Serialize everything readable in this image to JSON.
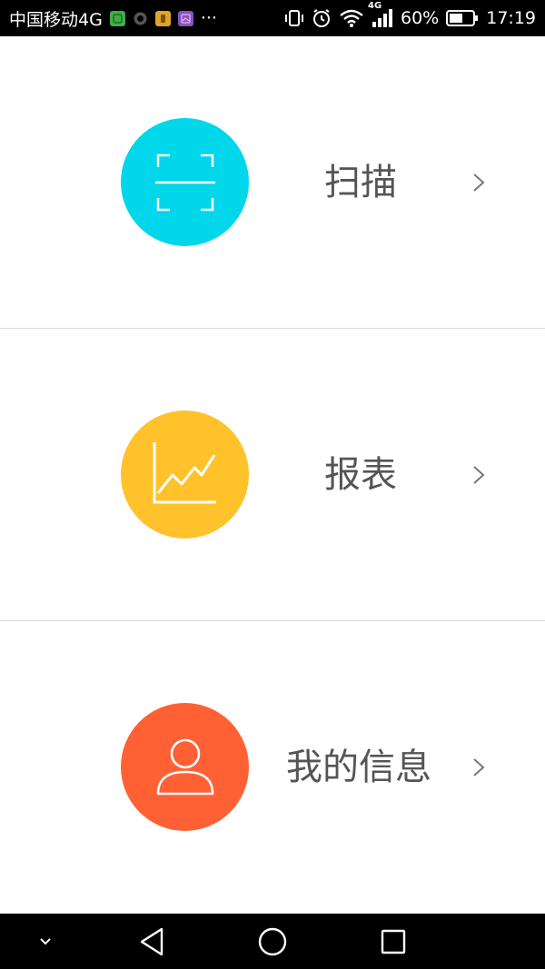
{
  "status_bar": {
    "carrier": "中国移动4G",
    "more": "···",
    "network_label": "4G",
    "battery_percent": "60%",
    "battery_level": 0.6,
    "time": "17:19",
    "icons": [
      "wechat-icon",
      "record-icon",
      "app-icon",
      "gallery-icon",
      "vibrate-icon",
      "alarm-icon",
      "wifi-icon",
      "signal-icon",
      "battery-icon"
    ]
  },
  "menu": {
    "items": [
      {
        "label": "扫描",
        "icon": "scan-icon",
        "color": "#00D7EB"
      },
      {
        "label": "报表",
        "icon": "chart-icon",
        "color": "#FFC22B"
      },
      {
        "label": "我的信息",
        "icon": "user-icon",
        "color": "#FF6135"
      }
    ]
  },
  "nav_bar": {
    "icons": [
      "dropdown-icon",
      "back-icon",
      "home-icon",
      "recents-icon"
    ]
  }
}
